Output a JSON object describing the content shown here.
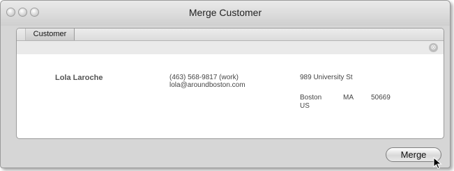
{
  "window": {
    "title": "Merge Customer"
  },
  "tabs": [
    {
      "label": "Customer"
    }
  ],
  "filter": {
    "clear_icon": "clear-circle-x-icon",
    "clear_glyph": "⊗"
  },
  "customer": {
    "name": "Lola Laroche",
    "phone": "(463) 568-9817 (work)",
    "email": "lola@aroundboston.com",
    "street": "989 University St",
    "city": "Boston",
    "state": "MA",
    "zip": "50669",
    "country": "US"
  },
  "actions": {
    "merge_label": "Merge"
  },
  "colors": {
    "window_bg": "#d6d6d6",
    "panel_bg": "#ffffff",
    "filter_bar": "#eaeaea"
  }
}
